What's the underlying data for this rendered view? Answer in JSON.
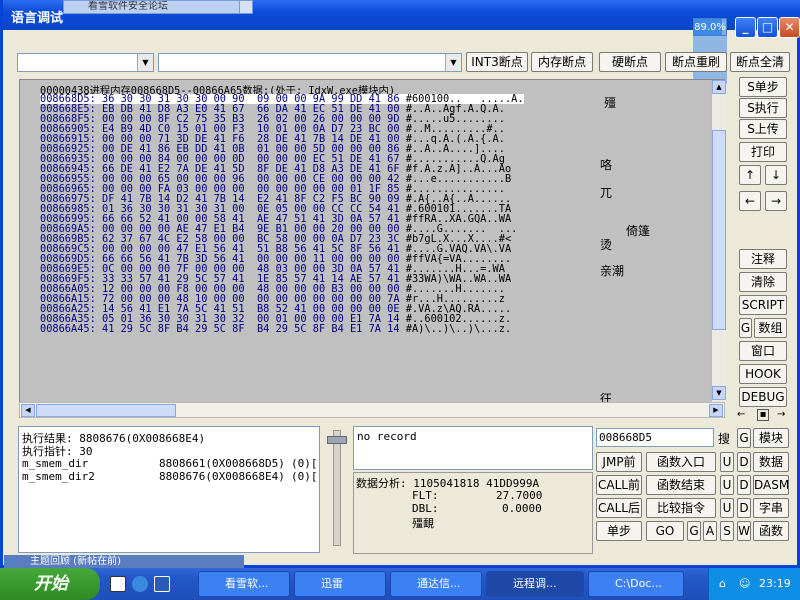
{
  "window": {
    "title": "语言调试",
    "background_tab_text": "看雪软件安全论坛",
    "cpu_percent_label": "89.0%",
    "cpu_percent": 89.0
  },
  "toolbar": {
    "combo1_value": "",
    "combo2_value": "",
    "btn_int3": "INT3断点",
    "btn_mem_bp": "内存断点",
    "btn_hw_bp": "硬断点",
    "btn_bp_reset": "断点重刷",
    "btn_bp_clear": "断点全清"
  },
  "memory": {
    "header": "00000438进程内存008668D5--00866A65数据:(处于:  IdxW.exe模块内)",
    "rows": [
      {
        "addr": "008668D5:",
        "hex": "36 30 30 31 30 30 00 90  09 00 00 9A 99 DD 41 86",
        "asc": "#600100..   .....A."
      },
      {
        "addr": "008668E5:",
        "hex": "EB DB 41 D8 A3 E0 41 67  66 DA 41 EC 51 DE 41 00",
        "asc": "#..A..Agf.A.Q.A."
      },
      {
        "addr": "008668F5:",
        "hex": "00 00 00 8F C2 75 35 B3  26 02 00 26 00 00 00 9D",
        "asc": "#.....u5........"
      },
      {
        "addr": "00866905:",
        "hex": "E4 B9 4D C0 15 01 00 F3  10 01 00 0A D7 23 BC 00",
        "asc": "#..M.........#.."
      },
      {
        "addr": "00866915:",
        "hex": "00 00 00 71 3D DE 41 F6  28 DE 41 7B 14 DE 41 00",
        "asc": "#...q.A.(.A.{.A."
      },
      {
        "addr": "00866925:",
        "hex": "00 DE 41 86 EB DD 41 0B  01 00 00 5D 00 00 00 86",
        "asc": "#..A..A....]...."
      },
      {
        "addr": "00866935:",
        "hex": "00 00 00 84 00 00 00 0D  00 00 00 EC 51 DE 41 67",
        "asc": "#...........Q.Ag"
      },
      {
        "addr": "00866945:",
        "hex": "66 DE 41 E2 7A DE 41 5D  8F DE 41 D8 A3 DE 41 6F",
        "asc": "#f.A.z.A]..A...Ao"
      },
      {
        "addr": "00866955:",
        "hex": "00 00 00 65 00 00 00 96  00 00 00 CE 00 00 00 42",
        "asc": "#...e...........B"
      },
      {
        "addr": "00866965:",
        "hex": "00 00 00 FA 03 00 00 00  00 00 00 00 00 01 1F 85",
        "asc": "#..............."
      },
      {
        "addr": "00866975:",
        "hex": "DF 41 7B 14 D2 41 7B 14  E2 41 8F C2 F5 BC 90 09",
        "asc": "#.A{..A{..A......"
      },
      {
        "addr": "00866985:",
        "hex": "01 36 30 30 31 30 31 00  0E 05 00 00 CC CC 54 41",
        "asc": "#.600101.......TA"
      },
      {
        "addr": "00866995:",
        "hex": "66 66 52 41 00 00 58 41  AE 47 51 41 3D 0A 57 41",
        "asc": "#ffRA..XA.GQA..WA"
      },
      {
        "addr": "008669A5:",
        "hex": "00 00 00 00 AE 47 E1 B4  9E B1 00 00 20 00 00 00",
        "asc": "#....G.......  ..."
      },
      {
        "addr": "008669B5:",
        "hex": "62 37 67 4C E2 58 00 00  BC 58 00 00 0A D7 23 3C",
        "asc": "#b7gL.X...X....#<"
      },
      {
        "addr": "008669C5:",
        "hex": "00 00 00 00 47 E1 56 41  51 B8 56 41 5C 8F 56 41",
        "asc": "#....G.VAQ.VA\\.VA"
      },
      {
        "addr": "008669D5:",
        "hex": "66 66 56 41 7B 3D 56 41  00 00 00 11 00 00 00 00",
        "asc": "#ffVA{=VA........"
      },
      {
        "addr": "008669E5:",
        "hex": "0C 00 00 00 7F 00 00 00  48 03 00 00 3D 0A 57 41",
        "asc": "#.......H...=.WA"
      },
      {
        "addr": "008669F5:",
        "hex": "33 33 57 41 29 5C 57 41  1E 85 57 41 14 AE 57 41",
        "asc": "#33WA)\\WA..WA..WA"
      },
      {
        "addr": "00866A05:",
        "hex": "12 00 00 00 F8 00 00 00  48 00 00 00 B3 00 00 00",
        "asc": "#.......H......."
      },
      {
        "addr": "00866A15:",
        "hex": "72 00 00 00 48 10 00 00  00 00 00 00 00 00 00 7A",
        "asc": "#r...H.........z"
      },
      {
        "addr": "00866A25:",
        "hex": "14 56 41 E1 7A 5C 41 51  B8 52 41 00 00 00 00 0E",
        "asc": "#.VA.z\\AQ.RA....."
      },
      {
        "addr": "00866A35:",
        "hex": "05 01 36 30 30 31 30 32  00 01 00 00 00 E1 7A 14",
        "asc": "#..600102......z."
      },
      {
        "addr": "00866A45:",
        "hex": "41 29 5C 8F B4 29 5C 8F  B4 29 5C 8F B4 E1 7A 14",
        "asc": "#A)\\..)\\..)\\...z."
      }
    ],
    "side_chars": [
      "殭",
      "咯",
      "兀",
      "倚篷",
      "烫",
      "亲潮",
      "彺"
    ]
  },
  "right_buttons": {
    "step_s": "S单步",
    "exec_s": "S执行",
    "up_s": "S上传",
    "print": "打印",
    "up": "↑",
    "down": "↓",
    "left": "←",
    "right": "→",
    "comment": "注释",
    "clear": "清除",
    "script": "SCRIPT",
    "g": "G",
    "data": "数组",
    "window": "窗口",
    "hook": "HOOK",
    "debug": "DEBUG"
  },
  "bottom_left": {
    "result_label": "执行结果:  8808676(0X008668E4)",
    "pointer_label": "执行指针: 30",
    "var1_name": "m_smem_dir",
    "var1_val": "8808661(0X008668D5)",
    "var1_extra": "(0)[",
    "var2_name": "m_smem_dir2",
    "var2_val": "8808676(0X008668E4)",
    "var2_extra": "(0)["
  },
  "record": {
    "text": "no record"
  },
  "analysis": {
    "title": "数据分析: 1105041818     41DD999A",
    "flt_label": "FLT:",
    "flt_value": "27.7000",
    "dbl_label": "DBL:",
    "dbl_value": "0.0000",
    "chars": "殭靦"
  },
  "address_input": {
    "value": "008668D5",
    "search_label": "搜"
  },
  "bottom_right": {
    "g_module": "G",
    "module": "模块",
    "jmp_prev": "JMP前",
    "func_entry": "函数入口",
    "u": "U",
    "d": "D",
    "data": "数据",
    "call_prev": "CALL前",
    "func_end": "函数结束",
    "dasm": "DASM",
    "call_next": "CALL后",
    "cmp_cmd": "比较指令",
    "strtab": "字串",
    "single_step": "单步",
    "go": "GO",
    "g2": "G",
    "a": "A",
    "s": "S",
    "w": "W",
    "funcs": "函数"
  },
  "taskbar": {
    "start": "开始",
    "bg_post_text": "主题回顾 (新帖在前)",
    "tasks": [
      {
        "label": "看雪软..."
      },
      {
        "label": "迅雷"
      },
      {
        "label": "通达信..."
      },
      {
        "label": "远程调..."
      },
      {
        "label": "C:\\Doc..."
      }
    ],
    "clock": "23:19"
  },
  "colors": {
    "titlebar": "#0a4bd8",
    "memory_bg": "#c0c0c0",
    "hex_text": "#000080",
    "taskbar": "#2457c8",
    "start": "#2e8a24"
  }
}
